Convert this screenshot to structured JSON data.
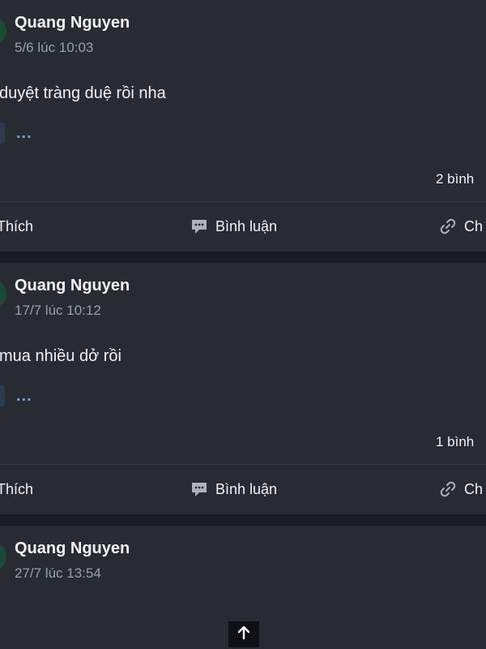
{
  "posts": [
    {
      "author": "Quang Nguyen",
      "timestamp": "5/6 lúc 10:03",
      "content": "duyệt tràng duệ rồi nha",
      "more": "...",
      "comment_count": "2 bình",
      "actions": {
        "like": "Thích",
        "comment": "Bình luận",
        "share": "Ch"
      }
    },
    {
      "author": "Quang Nguyen",
      "timestamp": "17/7 lúc 10:12",
      "content": "mua nhiều dở rồi",
      "more": "...",
      "comment_count": "1 bình",
      "actions": {
        "like": "Thích",
        "comment": "Bình luận",
        "share": "Ch"
      }
    },
    {
      "author": "Quang Nguyen",
      "timestamp": "27/7 lúc 13:54"
    }
  ],
  "icons": {
    "comment": "comment-icon",
    "share": "link-icon",
    "scroll_top": "arrow-up-icon"
  },
  "colors": {
    "background": "#191c21",
    "card": "#282b32",
    "text": "#f1f2f4",
    "muted": "#9aa0a8",
    "link": "#6fa3e6",
    "avatar": "#1b4b36"
  }
}
